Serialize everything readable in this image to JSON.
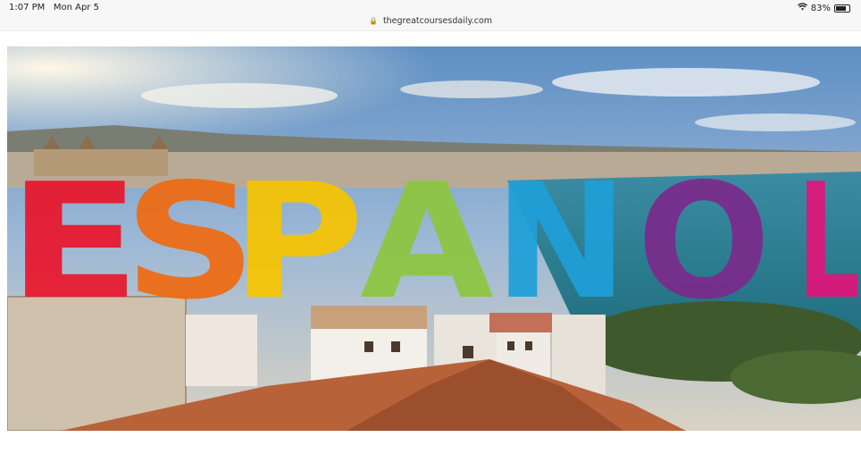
{
  "status_bar": {
    "time": "1:07 PM",
    "date": "Mon Apr 5",
    "battery": "83%",
    "battery_level": 0.83
  },
  "browser": {
    "url": "thegreatcoursesdaily.com"
  },
  "hero": {
    "title": "ESPAÑOL",
    "letter_colors": [
      "#e8162c",
      "#ee6b12",
      "#f5c400",
      "#8cc63f",
      "#1e9fd8",
      "#7b2a8c",
      "#e0147a"
    ]
  }
}
